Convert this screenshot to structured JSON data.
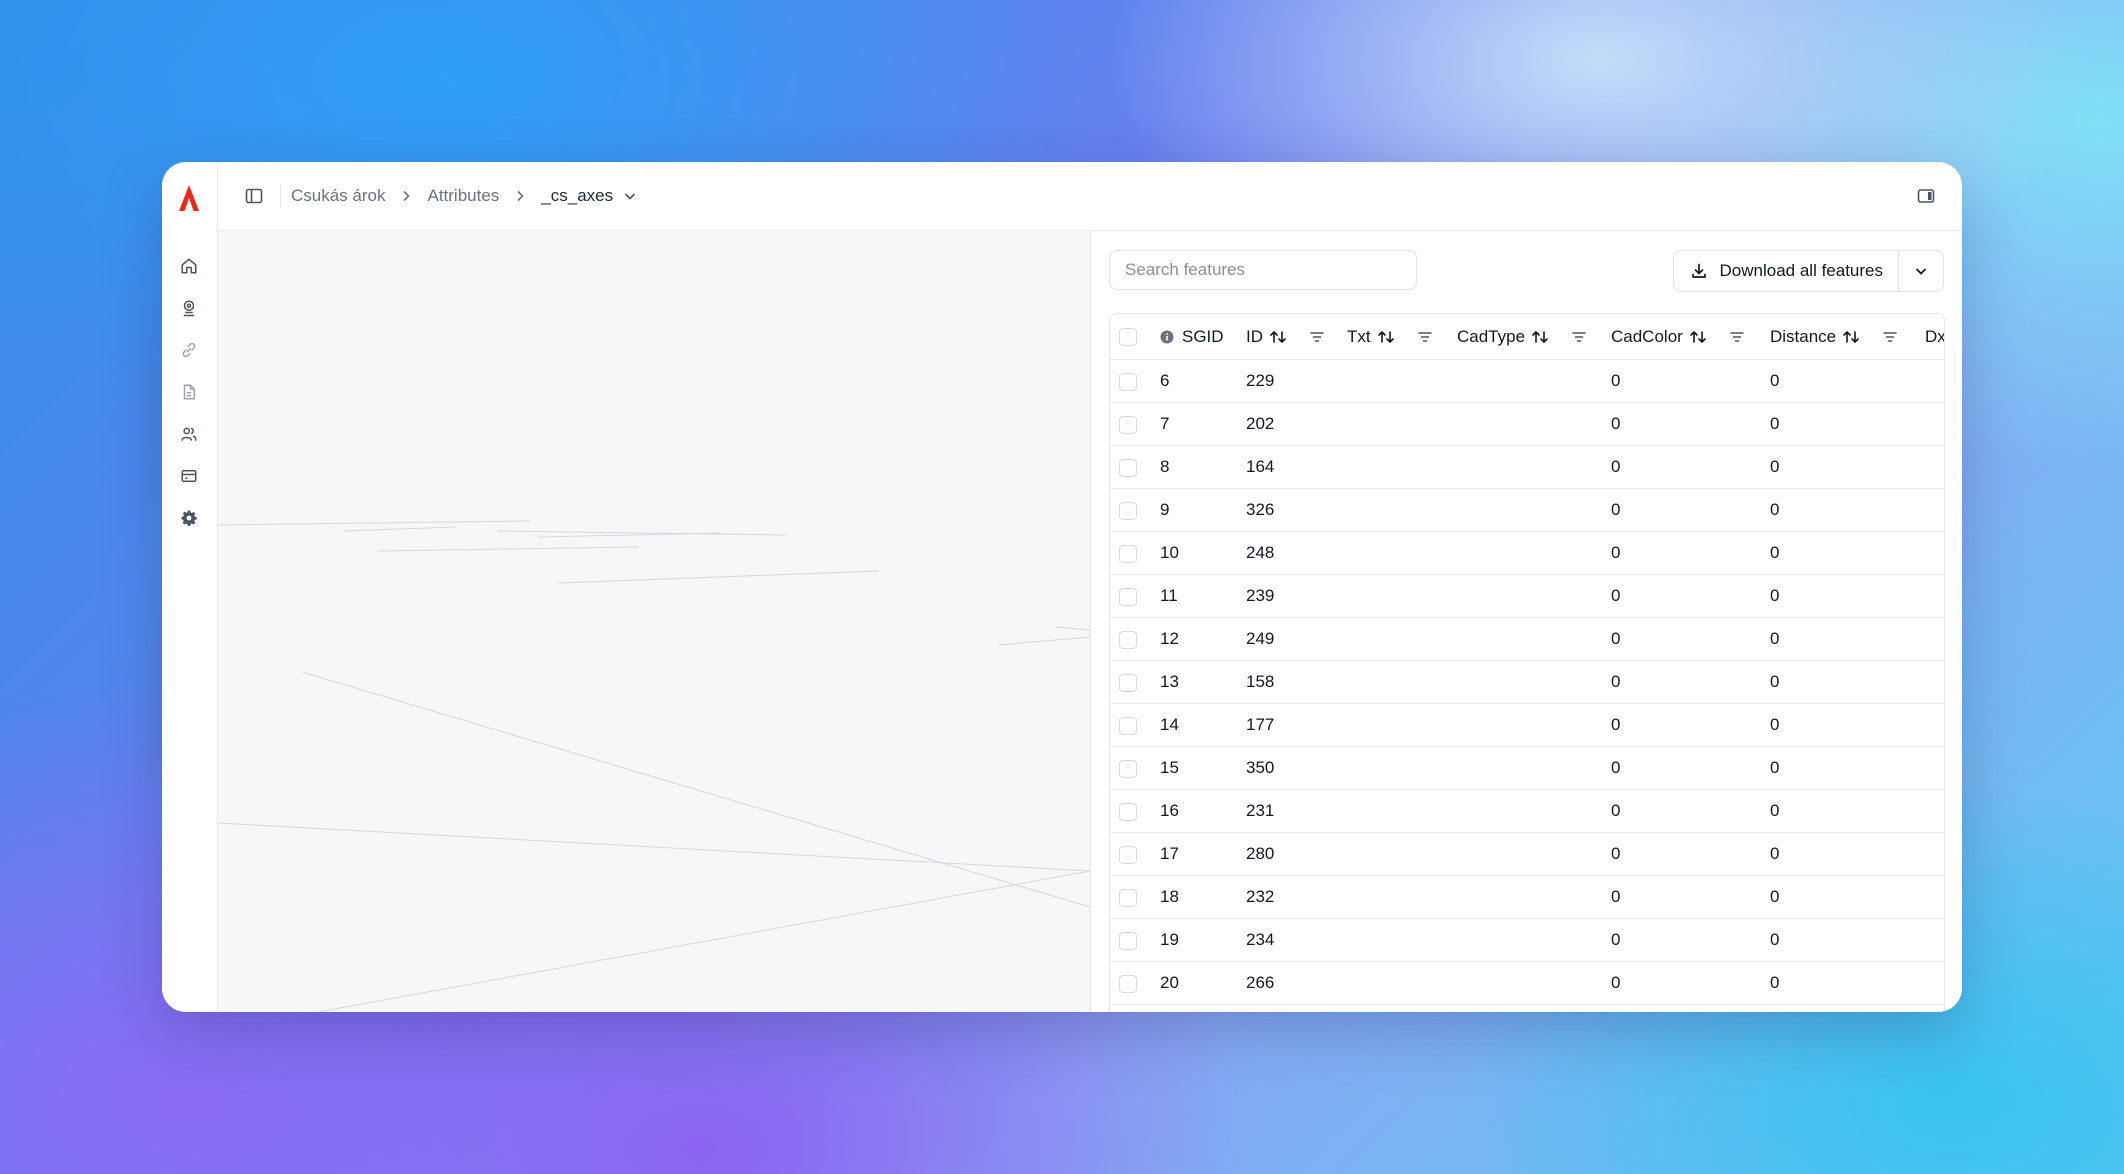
{
  "colors": {
    "brand": "#e8291c",
    "text": "#111827",
    "muted": "#6b7280",
    "border": "#e5e7eb"
  },
  "rail": {
    "items": [
      {
        "name": "home",
        "icon": "home-icon"
      },
      {
        "name": "map",
        "icon": "map-pin-icon"
      },
      {
        "name": "links",
        "icon": "link-icon"
      },
      {
        "name": "documents",
        "icon": "document-icon"
      },
      {
        "name": "users",
        "icon": "users-icon"
      },
      {
        "name": "billing",
        "icon": "credit-card-icon"
      },
      {
        "name": "settings",
        "icon": "gear-icon"
      }
    ]
  },
  "breadcrumb": {
    "project": "Csukás árok",
    "section": "Attributes",
    "layer": "_cs_axes"
  },
  "toolbar": {
    "search_placeholder": "Search features",
    "download_label": "Download all features"
  },
  "table": {
    "columns": {
      "sgid": "SGID",
      "id": "ID",
      "txt": "Txt",
      "cadtype": "CadType",
      "cadcolor": "CadColor",
      "distance": "Distance",
      "dx": "Dx"
    },
    "rows": [
      {
        "sgid": "6",
        "id": "229",
        "txt": "",
        "cadtype": "",
        "cadcolor": "0",
        "distance": "0"
      },
      {
        "sgid": "7",
        "id": "202",
        "txt": "",
        "cadtype": "",
        "cadcolor": "0",
        "distance": "0"
      },
      {
        "sgid": "8",
        "id": "164",
        "txt": "",
        "cadtype": "",
        "cadcolor": "0",
        "distance": "0"
      },
      {
        "sgid": "9",
        "id": "326",
        "txt": "",
        "cadtype": "",
        "cadcolor": "0",
        "distance": "0"
      },
      {
        "sgid": "10",
        "id": "248",
        "txt": "",
        "cadtype": "",
        "cadcolor": "0",
        "distance": "0"
      },
      {
        "sgid": "11",
        "id": "239",
        "txt": "",
        "cadtype": "",
        "cadcolor": "0",
        "distance": "0"
      },
      {
        "sgid": "12",
        "id": "249",
        "txt": "",
        "cadtype": "",
        "cadcolor": "0",
        "distance": "0"
      },
      {
        "sgid": "13",
        "id": "158",
        "txt": "",
        "cadtype": "",
        "cadcolor": "0",
        "distance": "0"
      },
      {
        "sgid": "14",
        "id": "177",
        "txt": "",
        "cadtype": "",
        "cadcolor": "0",
        "distance": "0"
      },
      {
        "sgid": "15",
        "id": "350",
        "txt": "",
        "cadtype": "",
        "cadcolor": "0",
        "distance": "0"
      },
      {
        "sgid": "16",
        "id": "231",
        "txt": "",
        "cadtype": "",
        "cadcolor": "0",
        "distance": "0"
      },
      {
        "sgid": "17",
        "id": "280",
        "txt": "",
        "cadtype": "",
        "cadcolor": "0",
        "distance": "0"
      },
      {
        "sgid": "18",
        "id": "232",
        "txt": "",
        "cadtype": "",
        "cadcolor": "0",
        "distance": "0"
      },
      {
        "sgid": "19",
        "id": "234",
        "txt": "",
        "cadtype": "",
        "cadcolor": "0",
        "distance": "0"
      },
      {
        "sgid": "20",
        "id": "266",
        "txt": "",
        "cadtype": "",
        "cadcolor": "0",
        "distance": "0"
      }
    ]
  }
}
